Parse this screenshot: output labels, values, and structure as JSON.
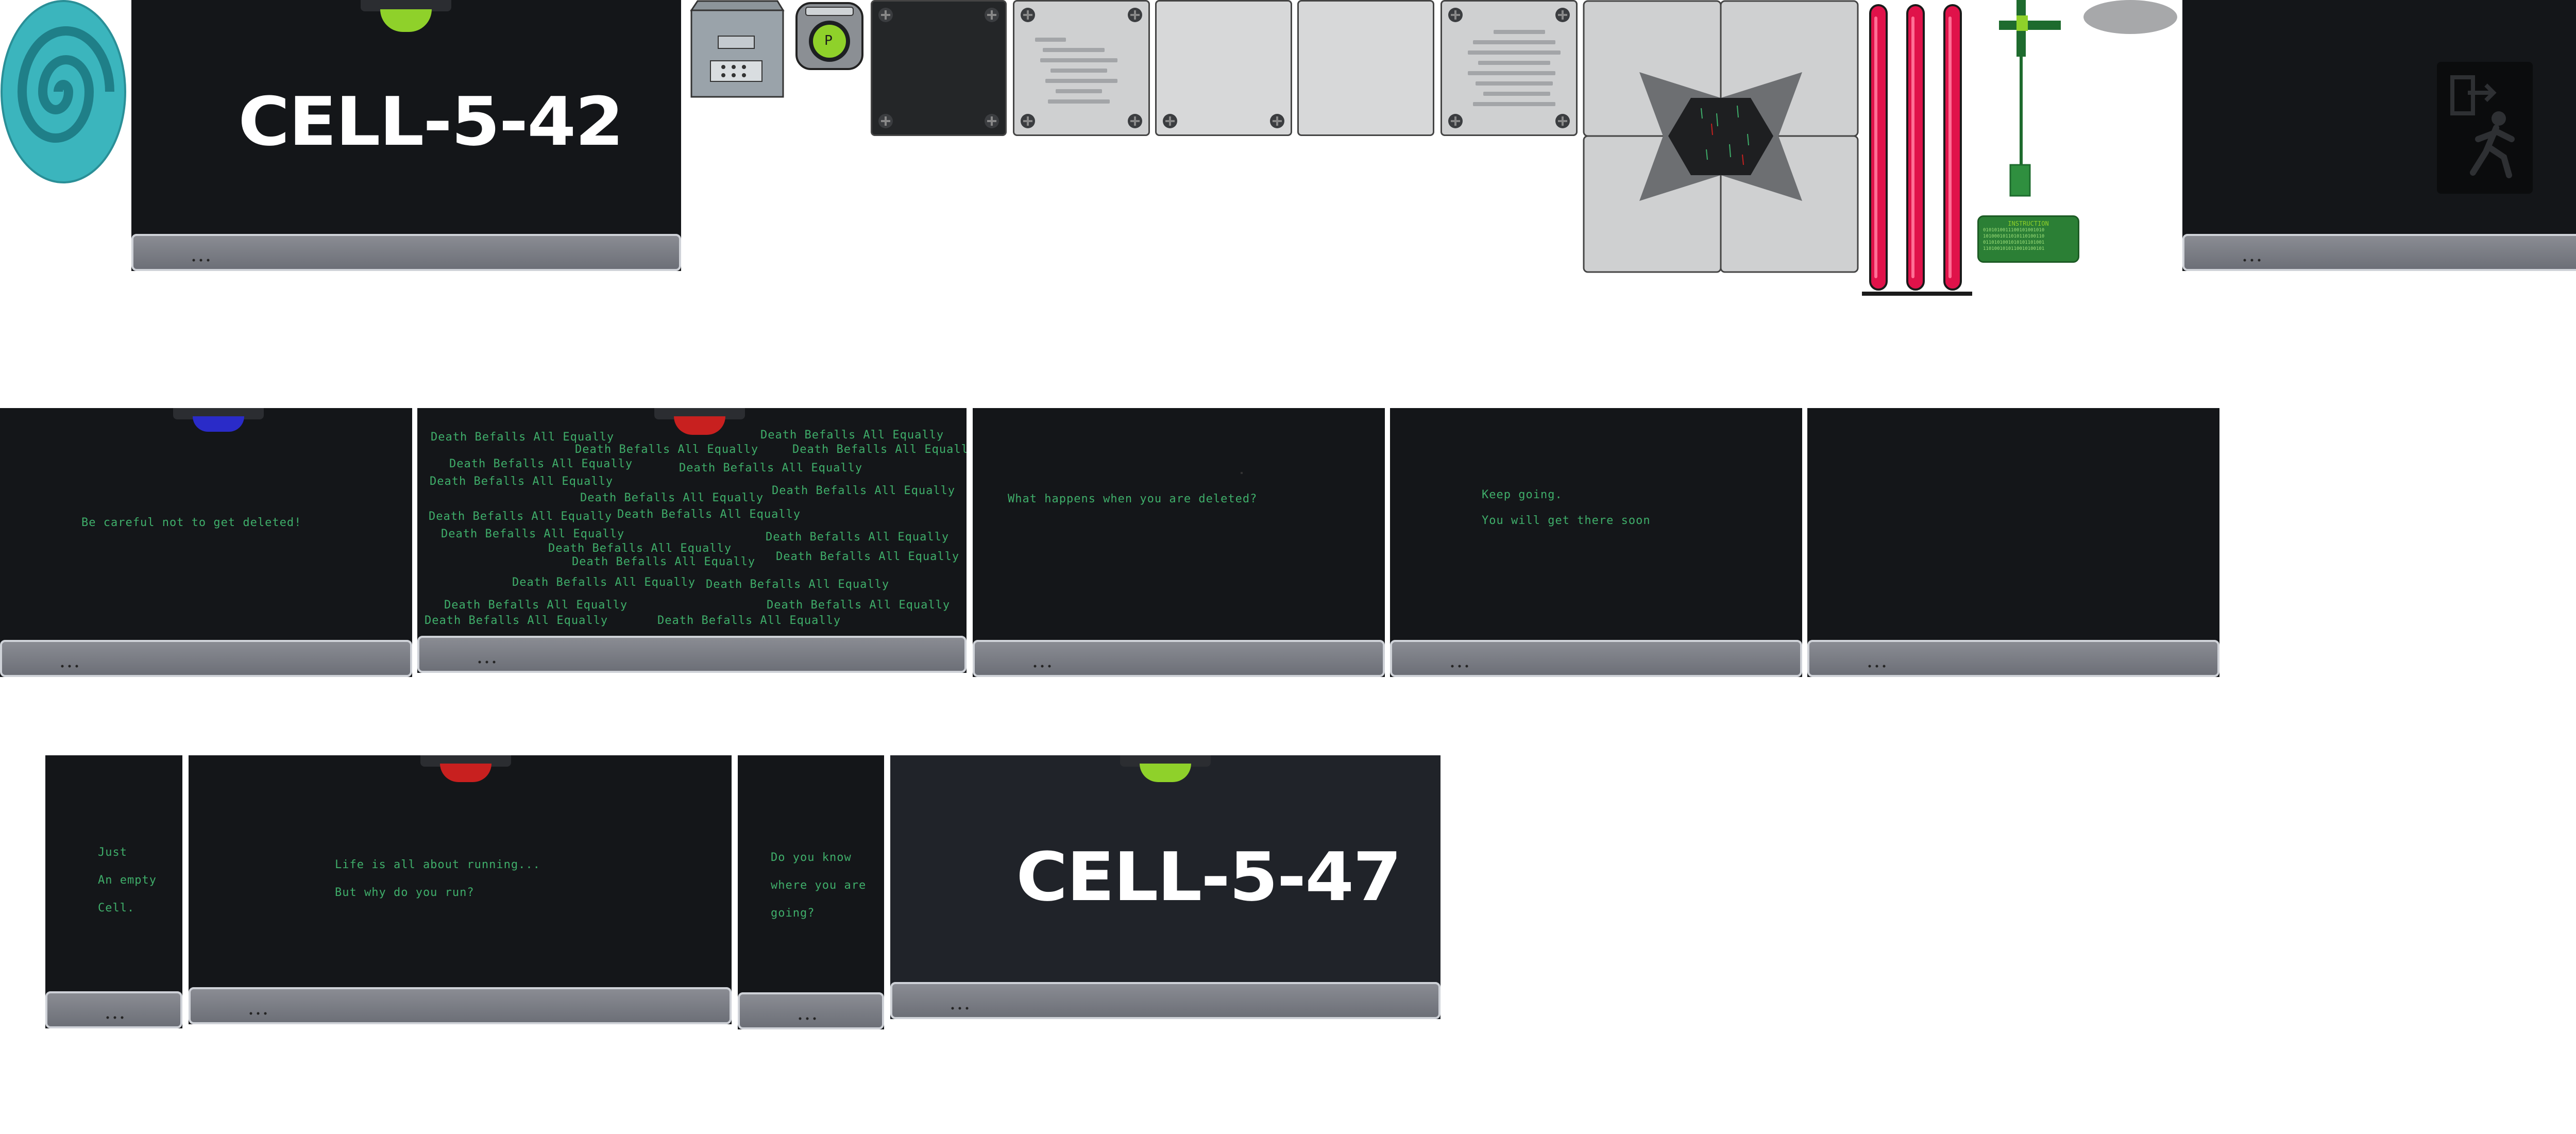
{
  "top": {
    "cell_542": {
      "label": "CELL-5-42"
    },
    "instruction_panel": {
      "title": "INSTRUCTION",
      "lines": [
        "0101010011100101001010",
        "1010001011010110100110",
        "0110101001010101101001",
        "1101001010110010100101"
      ]
    },
    "button_panel": {
      "letter": "P"
    }
  },
  "middle": {
    "cell_a": {
      "text": "Be careful not to get deleted!"
    },
    "cell_b": {
      "phrase": "Death Befalls All Equally",
      "repeats": [
        "Death Befalls All Equally",
        "Death Befalls All Equally",
        "Death Befalls All Equally",
        "Death Befalls All Equally",
        "Death Befalls All Equally",
        "Death Befalls All Equally",
        "Death Befalls All Equally",
        "Death Befalls All Equally",
        "Death Befalls All Equally",
        "Death Befalls All Equally",
        "Death Befalls All Equally",
        "Death Befalls All Equally",
        "Death Befalls All Equally",
        "Death Befalls All Equally",
        "Death Befalls All Equally",
        "Death Befalls All Equally",
        "Death Befalls All Equally",
        "Death Befalls All Equally",
        "Death Befalls All Equally",
        "Death Befalls All Equally",
        "Death Befalls All Equally",
        "Death Befalls All Equally",
        "Death Befalls All Equally"
      ]
    },
    "cell_c": {
      "text": "What happens when you are deleted?"
    },
    "cell_d": {
      "line1": "Keep going.",
      "line2": "You will get there soon"
    }
  },
  "bottom": {
    "cell_e": {
      "line1": "Just",
      "line2": "An empty",
      "line3": "Cell."
    },
    "cell_f": {
      "line1": "Life is all about running...",
      "line2": "But why do you run?"
    },
    "cell_g": {
      "line1": "Do you know",
      "line2": "where you are",
      "line3": "going?"
    },
    "cell_547": {
      "label": "CELL-5-47"
    }
  },
  "colors": {
    "cell_bg": "#141619",
    "text_green": "#3fae6a",
    "lamp_green": "#8fd12a",
    "lamp_red": "#c8201f",
    "lamp_blue": "#2a2bc8",
    "tube_pink": "#e0124a",
    "portal_teal": "#3bb5bd"
  },
  "icons": [
    "spiral-portal-icon",
    "exit-sign-icon",
    "button-p-icon",
    "control-box-icon"
  ]
}
